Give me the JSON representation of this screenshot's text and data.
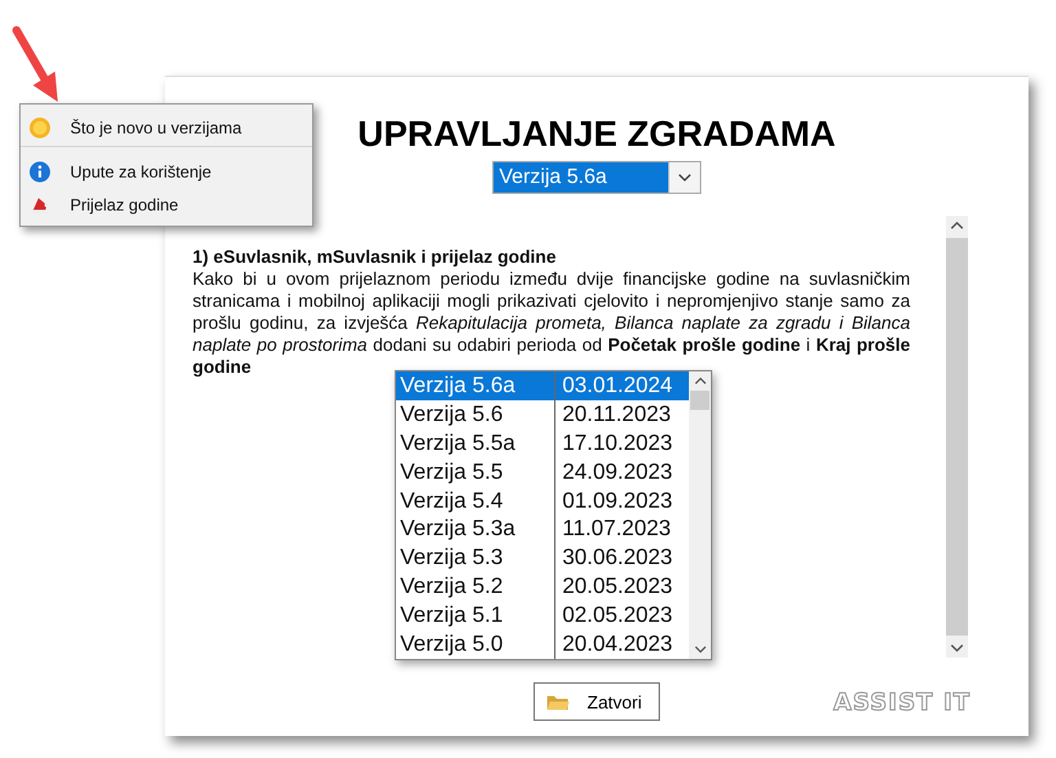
{
  "context_menu": {
    "items": [
      {
        "label": "Što je novo u verzijama",
        "kind": "new",
        "separator_after": true
      },
      {
        "label": "Upute za korištenje",
        "kind": "info",
        "separator_after": false
      },
      {
        "label": "Prijelaz godine",
        "kind": "hat",
        "separator_after": false
      }
    ]
  },
  "window": {
    "title": "UPRAVLJANJE ZGRADAMA",
    "version_select": {
      "value": "Verzija 5.6a"
    },
    "article": {
      "heading": "1) eSuvlasnik, mSuvlasnik i prijelaz godine",
      "body": "Kako bi u ovom prijelaznom periodu između dvije financijske godine na suvlasničkim stranicama i mobilnoj aplikaciji mogli prikazivati cjelovito i nepromjenjivo stanje samo za prošlu godinu, za izvješća *Rekapitulacija prometa, Bilanca naplate za zgradu i Bilanca naplate po prostorima* dodani su odabiri perioda od **Početak prošle godine** i **Kraj prošle godine**"
    },
    "versions": [
      {
        "name": "Verzija 5.6a",
        "date": "03.01.2024",
        "selected": true
      },
      {
        "name": "Verzija 5.6",
        "date": "20.11.2023",
        "selected": false
      },
      {
        "name": "Verzija 5.5a",
        "date": "17.10.2023",
        "selected": false
      },
      {
        "name": "Verzija 5.5",
        "date": "24.09.2023",
        "selected": false
      },
      {
        "name": "Verzija 5.4",
        "date": "01.09.2023",
        "selected": false
      },
      {
        "name": "Verzija 5.3a",
        "date": "11.07.2023",
        "selected": false
      },
      {
        "name": "Verzija 5.3",
        "date": "30.06.2023",
        "selected": false
      },
      {
        "name": "Verzija 5.2",
        "date": "20.05.2023",
        "selected": false
      },
      {
        "name": "Verzija 5.1",
        "date": "02.05.2023",
        "selected": false
      },
      {
        "name": "Verzija 5.0",
        "date": "20.04.2023",
        "selected": false
      }
    ],
    "close_button": "Zatvori",
    "logo": "ASSIST IT"
  }
}
